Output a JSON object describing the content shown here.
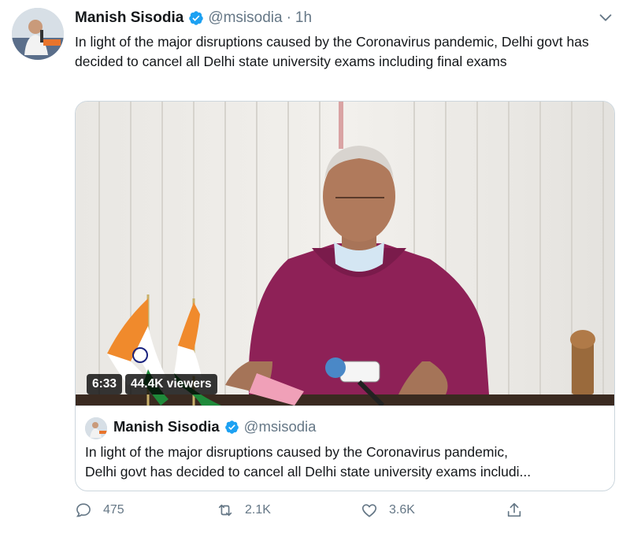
{
  "tweet": {
    "author_name": "Manish Sisodia",
    "handle": "@msisodia",
    "separator": "·",
    "time": "1h",
    "text": "In light of the major disruptions caused by the Coronavirus pandemic, Delhi govt has decided to cancel all Delhi state university exams including final exams"
  },
  "video": {
    "duration": "6:33",
    "viewers": "44.4K viewers"
  },
  "quoted_tweet": {
    "author_name": "Manish Sisodia",
    "handle": "@msisodia",
    "text_line1": "In light of the major disruptions caused by the Coronavirus pandemic,",
    "text_line2": "Delhi govt has decided to cancel all Delhi state university exams includi..."
  },
  "actions": {
    "replies": "475",
    "retweets": "2.1K",
    "likes": "3.6K"
  },
  "icons": {
    "verified": "verified-badge-icon",
    "caret": "chevron-down-icon",
    "reply": "reply-icon",
    "retweet": "retweet-icon",
    "like": "heart-icon",
    "share": "share-icon"
  },
  "colors": {
    "verified_blue": "#1da1f2",
    "secondary_text": "#657786",
    "border": "#ccd6dd"
  }
}
